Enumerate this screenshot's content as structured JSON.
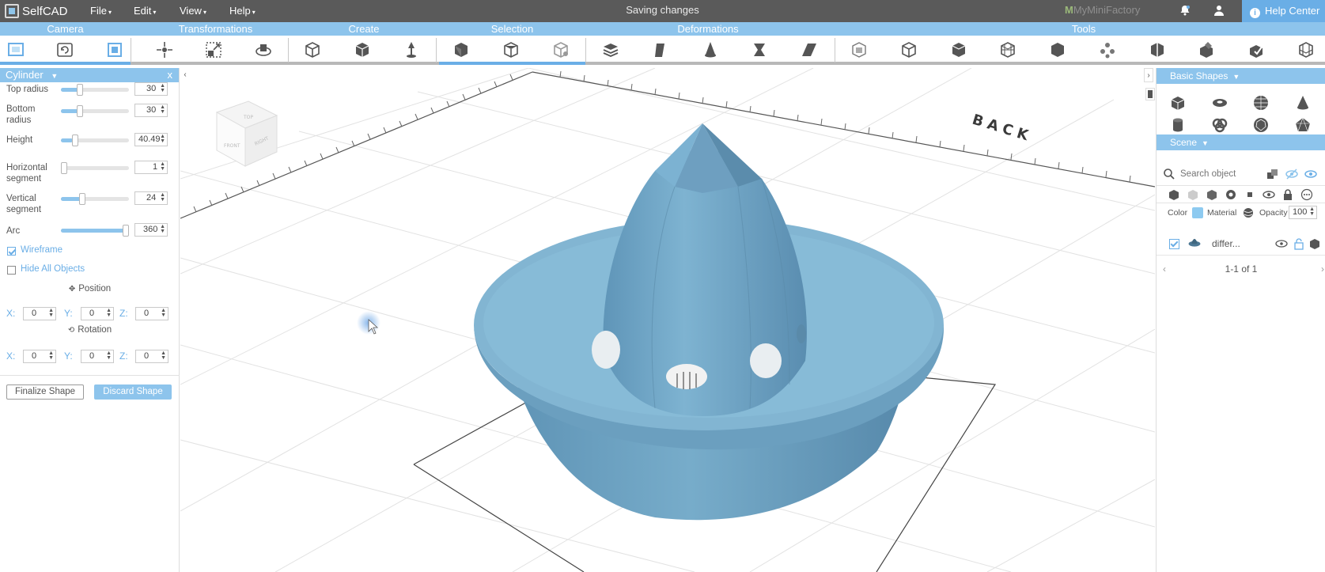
{
  "app": {
    "name": "SelfCAD"
  },
  "menu": {
    "items": [
      {
        "label": "File",
        "caret": "▾"
      },
      {
        "label": "Edit",
        "caret": "▾"
      },
      {
        "label": "View",
        "caret": "▾"
      },
      {
        "label": "Help",
        "caret": "▾"
      }
    ],
    "status": "Saving changes",
    "partner_prefix": "M",
    "partner": "MyMiniFactory",
    "help_center": "Help Center"
  },
  "sections": [
    "Camera",
    "Transformations",
    "Create",
    "Selection",
    "Deformations",
    "Tools"
  ],
  "left_panel": {
    "title": "Cylinder",
    "close": "x",
    "params": [
      {
        "label": "Top radius",
        "value": "30",
        "level": 0.25
      },
      {
        "label": "Bottom radius",
        "value": "30",
        "level": 0.25
      },
      {
        "label": "Height",
        "value": "40.49",
        "level": 0.18
      },
      {
        "label": "Horizontal segment",
        "value": "1",
        "level": 0.0
      },
      {
        "label": "Vertical segment",
        "value": "24",
        "level": 0.3
      },
      {
        "label": "Arc",
        "value": "360",
        "level": 1.0
      }
    ],
    "wireframe_label": "Wireframe",
    "wireframe_checked": true,
    "hide_all_label": "Hide All Objects",
    "hide_all_checked": false,
    "position_label": "Position",
    "rotation_label": "Rotation",
    "position": {
      "x": "0",
      "y": "0",
      "z": "0"
    },
    "rotation": {
      "x": "0",
      "y": "0",
      "z": "0"
    },
    "axis_labels": {
      "x": "X:",
      "y": "Y:",
      "z": "Z:"
    },
    "finalize_label": "Finalize Shape",
    "discard_label": "Discard Shape"
  },
  "viewport": {
    "grid_label": "BACK",
    "cube_labels": {
      "top": "TOP",
      "front": "FRONT",
      "right": "RIGHT"
    }
  },
  "right_panel": {
    "basic_shapes_label": "Basic Shapes",
    "scene_label": "Scene",
    "search_placeholder": "Search object",
    "color_label": "Color",
    "color_value": "#8dcaf0",
    "material_label": "Material",
    "opacity_label": "Opacity",
    "opacity_value": "100",
    "object_name": "differ...",
    "object_checked": true,
    "pager": "1-1 of 1"
  },
  "colors": {
    "accent": "#8dc4ec",
    "accent_dark": "#6aaee6",
    "model": "#6a9fbf",
    "menubar": "#5a5a5a"
  }
}
